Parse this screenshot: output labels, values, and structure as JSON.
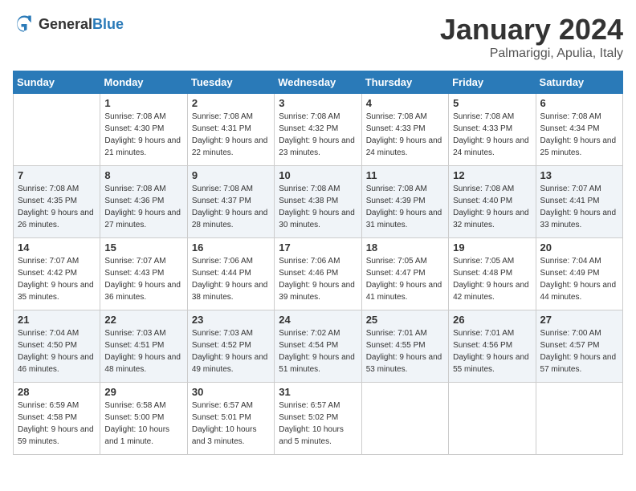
{
  "header": {
    "logo_general": "General",
    "logo_blue": "Blue",
    "month": "January 2024",
    "location": "Palmariggi, Apulia, Italy"
  },
  "days_of_week": [
    "Sunday",
    "Monday",
    "Tuesday",
    "Wednesday",
    "Thursday",
    "Friday",
    "Saturday"
  ],
  "weeks": [
    [
      {
        "day": "",
        "sunrise": "",
        "sunset": "",
        "daylight": ""
      },
      {
        "day": "1",
        "sunrise": "Sunrise: 7:08 AM",
        "sunset": "Sunset: 4:30 PM",
        "daylight": "Daylight: 9 hours and 21 minutes."
      },
      {
        "day": "2",
        "sunrise": "Sunrise: 7:08 AM",
        "sunset": "Sunset: 4:31 PM",
        "daylight": "Daylight: 9 hours and 22 minutes."
      },
      {
        "day": "3",
        "sunrise": "Sunrise: 7:08 AM",
        "sunset": "Sunset: 4:32 PM",
        "daylight": "Daylight: 9 hours and 23 minutes."
      },
      {
        "day": "4",
        "sunrise": "Sunrise: 7:08 AM",
        "sunset": "Sunset: 4:33 PM",
        "daylight": "Daylight: 9 hours and 24 minutes."
      },
      {
        "day": "5",
        "sunrise": "Sunrise: 7:08 AM",
        "sunset": "Sunset: 4:33 PM",
        "daylight": "Daylight: 9 hours and 24 minutes."
      },
      {
        "day": "6",
        "sunrise": "Sunrise: 7:08 AM",
        "sunset": "Sunset: 4:34 PM",
        "daylight": "Daylight: 9 hours and 25 minutes."
      }
    ],
    [
      {
        "day": "7",
        "sunrise": "Sunrise: 7:08 AM",
        "sunset": "Sunset: 4:35 PM",
        "daylight": "Daylight: 9 hours and 26 minutes."
      },
      {
        "day": "8",
        "sunrise": "Sunrise: 7:08 AM",
        "sunset": "Sunset: 4:36 PM",
        "daylight": "Daylight: 9 hours and 27 minutes."
      },
      {
        "day": "9",
        "sunrise": "Sunrise: 7:08 AM",
        "sunset": "Sunset: 4:37 PM",
        "daylight": "Daylight: 9 hours and 28 minutes."
      },
      {
        "day": "10",
        "sunrise": "Sunrise: 7:08 AM",
        "sunset": "Sunset: 4:38 PM",
        "daylight": "Daylight: 9 hours and 30 minutes."
      },
      {
        "day": "11",
        "sunrise": "Sunrise: 7:08 AM",
        "sunset": "Sunset: 4:39 PM",
        "daylight": "Daylight: 9 hours and 31 minutes."
      },
      {
        "day": "12",
        "sunrise": "Sunrise: 7:08 AM",
        "sunset": "Sunset: 4:40 PM",
        "daylight": "Daylight: 9 hours and 32 minutes."
      },
      {
        "day": "13",
        "sunrise": "Sunrise: 7:07 AM",
        "sunset": "Sunset: 4:41 PM",
        "daylight": "Daylight: 9 hours and 33 minutes."
      }
    ],
    [
      {
        "day": "14",
        "sunrise": "Sunrise: 7:07 AM",
        "sunset": "Sunset: 4:42 PM",
        "daylight": "Daylight: 9 hours and 35 minutes."
      },
      {
        "day": "15",
        "sunrise": "Sunrise: 7:07 AM",
        "sunset": "Sunset: 4:43 PM",
        "daylight": "Daylight: 9 hours and 36 minutes."
      },
      {
        "day": "16",
        "sunrise": "Sunrise: 7:06 AM",
        "sunset": "Sunset: 4:44 PM",
        "daylight": "Daylight: 9 hours and 38 minutes."
      },
      {
        "day": "17",
        "sunrise": "Sunrise: 7:06 AM",
        "sunset": "Sunset: 4:46 PM",
        "daylight": "Daylight: 9 hours and 39 minutes."
      },
      {
        "day": "18",
        "sunrise": "Sunrise: 7:05 AM",
        "sunset": "Sunset: 4:47 PM",
        "daylight": "Daylight: 9 hours and 41 minutes."
      },
      {
        "day": "19",
        "sunrise": "Sunrise: 7:05 AM",
        "sunset": "Sunset: 4:48 PM",
        "daylight": "Daylight: 9 hours and 42 minutes."
      },
      {
        "day": "20",
        "sunrise": "Sunrise: 7:04 AM",
        "sunset": "Sunset: 4:49 PM",
        "daylight": "Daylight: 9 hours and 44 minutes."
      }
    ],
    [
      {
        "day": "21",
        "sunrise": "Sunrise: 7:04 AM",
        "sunset": "Sunset: 4:50 PM",
        "daylight": "Daylight: 9 hours and 46 minutes."
      },
      {
        "day": "22",
        "sunrise": "Sunrise: 7:03 AM",
        "sunset": "Sunset: 4:51 PM",
        "daylight": "Daylight: 9 hours and 48 minutes."
      },
      {
        "day": "23",
        "sunrise": "Sunrise: 7:03 AM",
        "sunset": "Sunset: 4:52 PM",
        "daylight": "Daylight: 9 hours and 49 minutes."
      },
      {
        "day": "24",
        "sunrise": "Sunrise: 7:02 AM",
        "sunset": "Sunset: 4:54 PM",
        "daylight": "Daylight: 9 hours and 51 minutes."
      },
      {
        "day": "25",
        "sunrise": "Sunrise: 7:01 AM",
        "sunset": "Sunset: 4:55 PM",
        "daylight": "Daylight: 9 hours and 53 minutes."
      },
      {
        "day": "26",
        "sunrise": "Sunrise: 7:01 AM",
        "sunset": "Sunset: 4:56 PM",
        "daylight": "Daylight: 9 hours and 55 minutes."
      },
      {
        "day": "27",
        "sunrise": "Sunrise: 7:00 AM",
        "sunset": "Sunset: 4:57 PM",
        "daylight": "Daylight: 9 hours and 57 minutes."
      }
    ],
    [
      {
        "day": "28",
        "sunrise": "Sunrise: 6:59 AM",
        "sunset": "Sunset: 4:58 PM",
        "daylight": "Daylight: 9 hours and 59 minutes."
      },
      {
        "day": "29",
        "sunrise": "Sunrise: 6:58 AM",
        "sunset": "Sunset: 5:00 PM",
        "daylight": "Daylight: 10 hours and 1 minute."
      },
      {
        "day": "30",
        "sunrise": "Sunrise: 6:57 AM",
        "sunset": "Sunset: 5:01 PM",
        "daylight": "Daylight: 10 hours and 3 minutes."
      },
      {
        "day": "31",
        "sunrise": "Sunrise: 6:57 AM",
        "sunset": "Sunset: 5:02 PM",
        "daylight": "Daylight: 10 hours and 5 minutes."
      },
      {
        "day": "",
        "sunrise": "",
        "sunset": "",
        "daylight": ""
      },
      {
        "day": "",
        "sunrise": "",
        "sunset": "",
        "daylight": ""
      },
      {
        "day": "",
        "sunrise": "",
        "sunset": "",
        "daylight": ""
      }
    ]
  ]
}
